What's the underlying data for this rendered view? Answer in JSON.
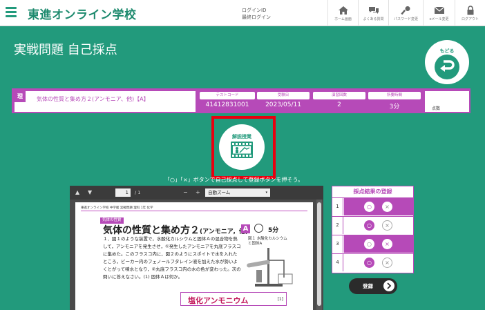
{
  "header": {
    "brand": "東進オンライン学校",
    "login_id_label": "ログインID",
    "last_login_label": "最終ログイン",
    "nav": [
      {
        "icon": "home-icon",
        "label": "ホーム画面"
      },
      {
        "icon": "chat-icon",
        "label": "よくある質問"
      },
      {
        "icon": "key-icon",
        "label": "パスワード変更"
      },
      {
        "icon": "mail-icon",
        "label": "eメール変更"
      },
      {
        "icon": "lock-icon",
        "label": "ログアウト"
      }
    ]
  },
  "page_title": "実戦問題 自己採点",
  "back_button": {
    "label": "もどる"
  },
  "problem": {
    "subject": "理",
    "title": "気体の性質と集め方２(アンモニア、他)【A】",
    "meta": [
      {
        "label": "テストコード",
        "value": "41412831001"
      },
      {
        "label": "受験日",
        "value": "2023/05/11"
      },
      {
        "label": "演習回数",
        "value": "2"
      },
      {
        "label": "所要時間",
        "value": "3分"
      }
    ],
    "score_label": "点数"
  },
  "video_button": {
    "label": "解説授業"
  },
  "instruction": "「○」「×」ボタンで自己採点して登録ボタンを押そう。",
  "pdf": {
    "page_number": "1",
    "page_total": "/ 1",
    "zoom_option": "自動ズーム",
    "doc_header": "東進オンライン学校 中学版 実戦問題 理科 1年 化学",
    "section_tag": "気体の性質",
    "doc_title_main": "気体の性質と集め方２",
    "doc_title_paren": "(アンモニア，他)",
    "badge": "A",
    "minutes": "5分",
    "body": "１．図１のような装置で，水酸化カルシウムと固体Ａの混合物を熱して，アンモニアを発生させ，①発生したアンモニアを丸底フラスコに集めた。このフラスコ内に，図２のようにスポイトで水を入れたところ，ビーカー内のフェノールフタレイン液を加えた水が勢いよくとがって噴水となり，②丸底フラスコ内の水の色が変わった。次の問いに答えなさい。(1) 固体Ａは何か。",
    "figure_label": "図１ 水酸化カルシウムと固体A",
    "answer": "塩化アンモニウム",
    "answer_num": "[1]"
  },
  "score_panel": {
    "title": "採点結果の登録",
    "ok_symbol": "○",
    "ng_symbol": "×",
    "rows": [
      {
        "num": "1",
        "filled": true
      },
      {
        "num": "2",
        "filled": false
      },
      {
        "num": "3",
        "filled": true
      },
      {
        "num": "4",
        "filled": false
      }
    ]
  },
  "register_button": {
    "label": "登録"
  },
  "colors": {
    "primary": "#229a7c",
    "accent": "#b64ab8",
    "highlight": "#e8000f"
  }
}
